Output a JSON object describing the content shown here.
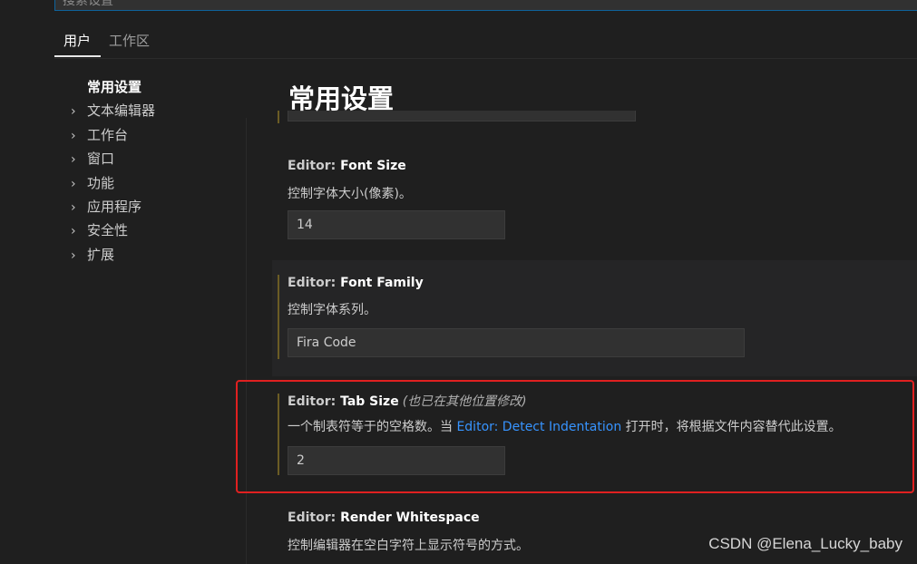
{
  "search": {
    "placeholder": "搜索设置"
  },
  "tabs": [
    {
      "label": "用户"
    },
    {
      "label": "工作区"
    }
  ],
  "toc": {
    "active": "常用设置",
    "items": [
      {
        "label": "文本编辑器"
      },
      {
        "label": "工作台"
      },
      {
        "label": "窗口"
      },
      {
        "label": "功能"
      },
      {
        "label": "应用程序"
      },
      {
        "label": "安全性"
      },
      {
        "label": "扩展"
      }
    ],
    "chevron": "chevron-right-icon"
  },
  "main": {
    "title": "常用设置",
    "settings": [
      {
        "category": "Editor: ",
        "name": "Font Size",
        "description": "控制字体大小(像素)。",
        "value": "14"
      },
      {
        "category": "Editor: ",
        "name": "Font Family",
        "description": "控制字体系列。",
        "value": "Fira Code"
      },
      {
        "category": "Editor: ",
        "name": "Tab Size",
        "note": "(也已在其他位置修改)",
        "description_prefix": "一个制表符等于的空格数。当 ",
        "description_link": "Editor: Detect Indentation",
        "description_suffix": " 打开时，将根据文件内容替代此设置。",
        "value": "2"
      },
      {
        "category": "Editor: ",
        "name": "Render Whitespace",
        "description": "控制编辑器在空白字符上显示符号的方式。"
      }
    ]
  },
  "watermark": "CSDN @Elena_Lucky_baby",
  "colors": {
    "accent": "#0e639c",
    "link": "#3794ff",
    "highlight_border": "#e02020",
    "modified_bar": "#6b5c24"
  }
}
